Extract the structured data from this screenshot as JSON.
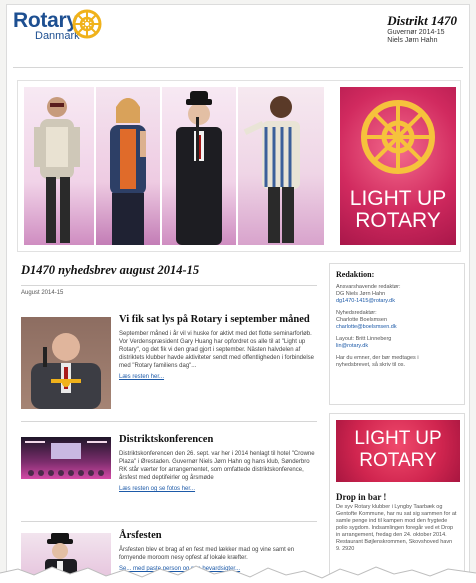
{
  "header": {
    "logo_word": "Rotary",
    "logo_sub": "Danmark",
    "district_title": "Distrikt 1470",
    "district_line1": "Guvernør 2014-15",
    "district_line2": "Niels Jørn Hahn"
  },
  "hero": {
    "poster_line1": "LIGHT UP",
    "poster_line2": "ROTARY"
  },
  "main": {
    "newsletter_title": "D1470 nyhedsbrev august 2014-15",
    "issue_date": "August 2014-15",
    "articles": [
      {
        "title": "Vi fik sat lys på Rotary i september måned",
        "text": "September måned i år vil vi huske for aktivt med det flotte seminarforløb. Vor Verdenspræsident Gary Huang har opfordret os alle til at \"Light up Rotary\", og det fik vi den grad gjort i september. Nästen halvdelen af distriktets klubber havde aktiviteter sendt med offentligheden i forbindelse med \"Rotary familiens dag\"...",
        "link": "Læs resten her..."
      },
      {
        "title": "Distriktskonferencen",
        "text": "Distriktskonferencen den 26. sept. var her i 2014 henlagt til hotel \"Crowne Plaza\" i Ørestaden. Guvernør Niels Jørn Hahn og hans klub, Sønderbro RK står værter for arrangementet, som omfattede distriktskonference, årsfest med deptifeirler og årsmøde",
        "link": "Læs resten og se fotos her..."
      },
      {
        "title": "Årsfesten",
        "text": "Årsfesten blev et brag af en fest med lækker mad og vine samt en fornyende moroom nesy opfest af lokale kræfter.",
        "link": "Se... med paste person og nye bevardsigter..."
      }
    ]
  },
  "sidebar": {
    "editorial": {
      "heading": "Redaktion:",
      "line1": "Ansvarshavende redaktør:",
      "line2": "DG Niels Jørn Hahn",
      "line3": "dg1470-1415@rotary.dk",
      "line4": "Nyhedsredaktør:",
      "line5": "Charlotte Boelsmsen",
      "line6": "charlotte@boelsmsen.dk",
      "line7": "Layout: Britt Linneberg",
      "line8": "lin@rotary.dk",
      "line9": "Har du emner, der bør medtages i",
      "line10": "nyhedsbrevet, så skriv til os."
    },
    "drop": {
      "poster_line1": "LIGHT UP",
      "poster_line2": "ROTARY",
      "heading": "Drop in bar !",
      "text": "De syv Rotary klubber i Lyngby Taarbæk og Gentofte Kommune, har nu sat sig sammen for at samle penge ind til kampen mod den frygtede polio sygdom. Indsamlingen foregår ved et Drop in arrangement, fredag den 24. oktober 2014. Restaurant Bøjlenskrommen, Skovshoved havn 9. 2920"
    }
  },
  "colors": {
    "rotary_blue": "#1d4f91",
    "rotary_gold": "#f0b21b",
    "poster_pink": "#d12a5f",
    "link_blue": "#1d5aa8"
  }
}
